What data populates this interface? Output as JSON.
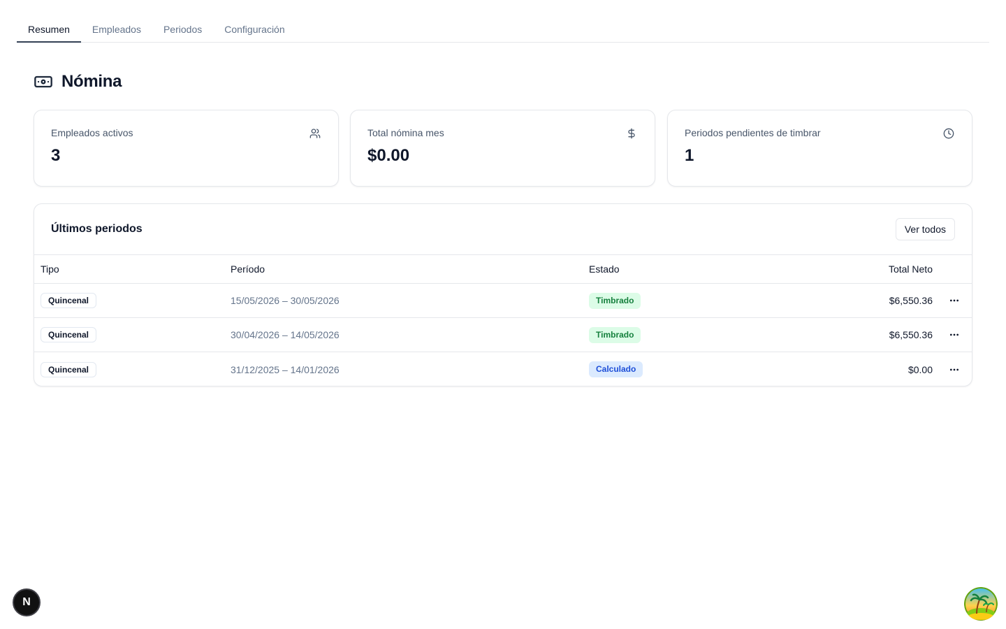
{
  "tabs": [
    {
      "label": "Resumen",
      "active": true
    },
    {
      "label": "Empleados",
      "active": false
    },
    {
      "label": "Periodos",
      "active": false
    },
    {
      "label": "Configuración",
      "active": false
    }
  ],
  "header": {
    "title": "Nómina",
    "icon": "banknote-icon"
  },
  "stats": [
    {
      "label": "Empleados activos",
      "value": "3",
      "icon": "users-icon"
    },
    {
      "label": "Total nómina mes",
      "value": "$0.00",
      "icon": "dollar-icon"
    },
    {
      "label": "Periodos pendientes de timbrar",
      "value": "1",
      "icon": "clock-icon"
    }
  ],
  "periods": {
    "title": "Últimos periodos",
    "view_all_label": "Ver todos",
    "columns": {
      "tipo": "Tipo",
      "periodo": "Período",
      "estado": "Estado",
      "total": "Total Neto"
    },
    "rows": [
      {
        "tipo": "Quincenal",
        "periodo": "15/05/2026 – 30/05/2026",
        "estado": "Timbrado",
        "total": "$6,550.36"
      },
      {
        "tipo": "Quincenal",
        "periodo": "30/04/2026 – 14/05/2026",
        "estado": "Timbrado",
        "total": "$6,550.36"
      },
      {
        "tipo": "Quincenal",
        "periodo": "31/12/2025 – 14/01/2026",
        "estado": "Calculado",
        "total": "$0.00"
      }
    ]
  },
  "dev_badge": {
    "letter": "N"
  },
  "colors": {
    "timbrado_bg": "#dcfce7",
    "timbrado_fg": "#15803d",
    "calculado_bg": "#dbeafe",
    "calculado_fg": "#1d4ed8",
    "tab_underline": "#334155"
  }
}
